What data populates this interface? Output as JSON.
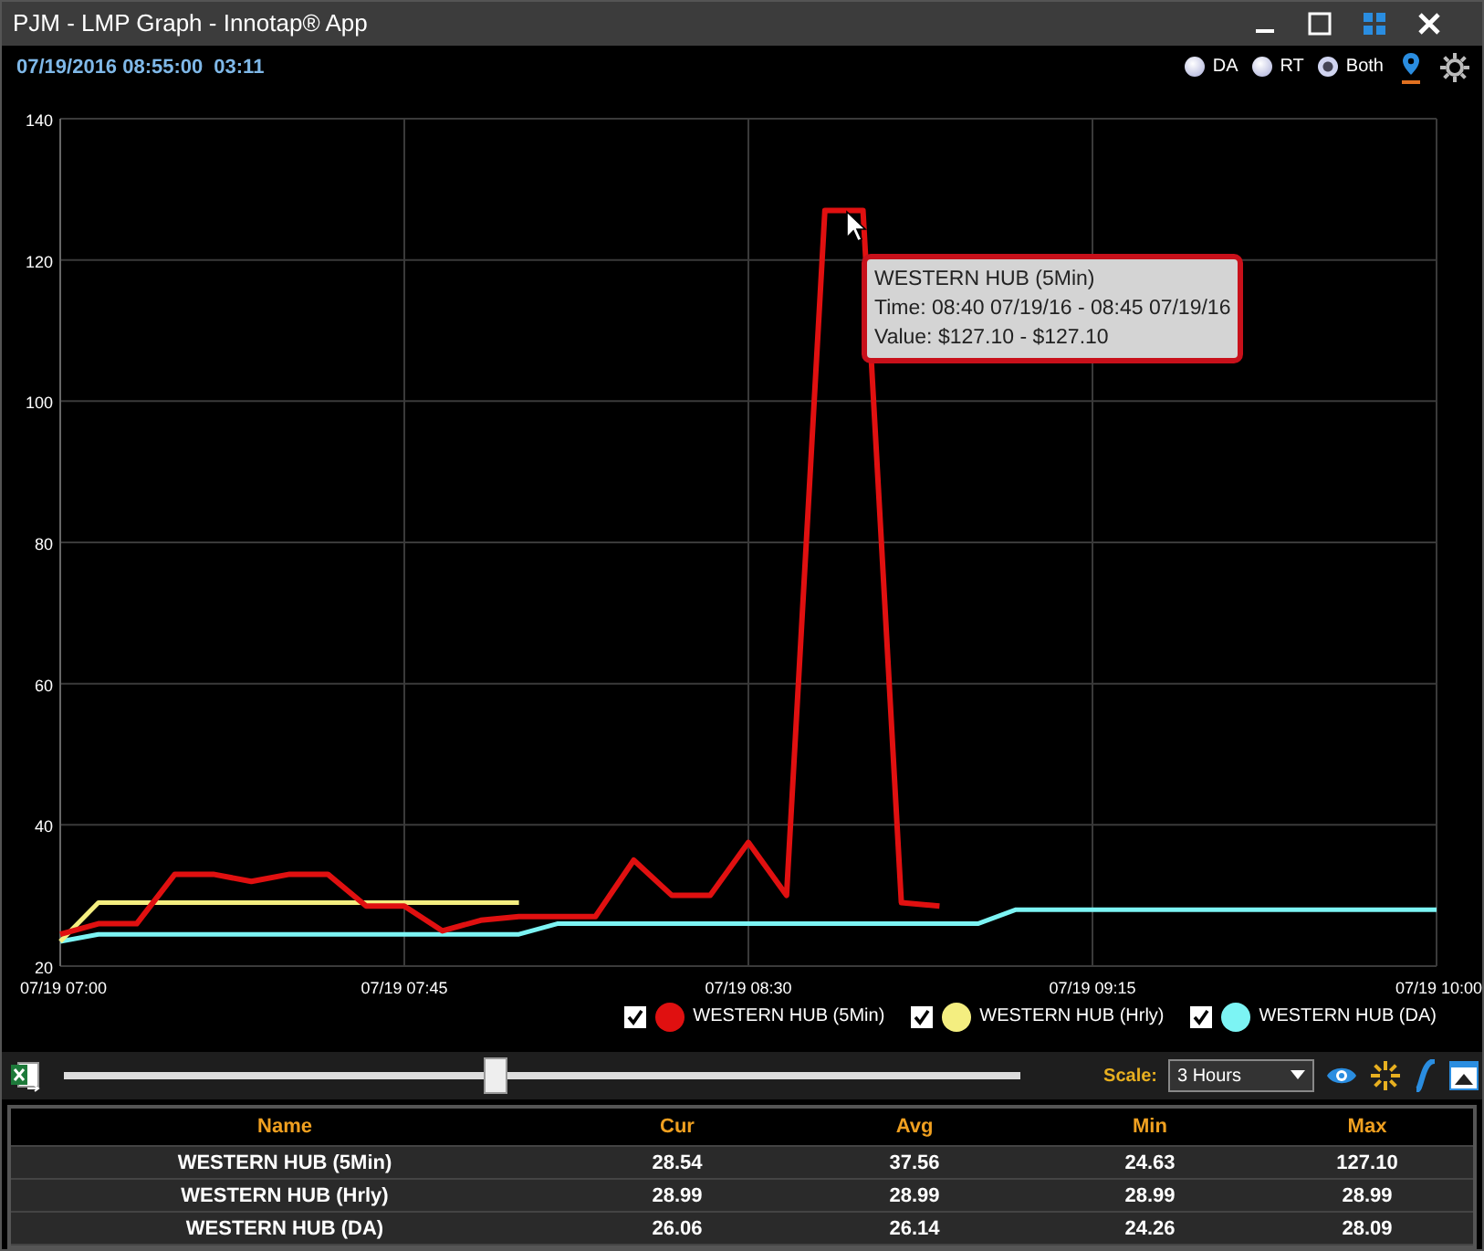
{
  "window": {
    "title": "PJM - LMP Graph - Innotap® App"
  },
  "header": {
    "datetime": "07/19/2016 08:55:00",
    "countdown": "03:11",
    "modes": [
      {
        "label": "DA",
        "selected": false
      },
      {
        "label": "RT",
        "selected": false
      },
      {
        "label": "Both",
        "selected": true
      }
    ]
  },
  "chart": {
    "chart_data": {
      "type": "line",
      "grid": true,
      "categories": [
        "07/19 07:00",
        null,
        null,
        null,
        null,
        null,
        null,
        null,
        null,
        "07/19 07:45",
        null,
        null,
        null,
        null,
        null,
        null,
        null,
        null,
        "07/19 08:30",
        null,
        null,
        null,
        null,
        null,
        null,
        null,
        null,
        "07/19 09:15",
        null,
        null,
        null,
        null,
        null,
        null,
        null,
        null,
        "07/19 10:00"
      ],
      "ylim": [
        20,
        140
      ],
      "yticks": [
        20,
        40,
        60,
        80,
        100,
        120,
        140
      ],
      "series": [
        {
          "name": "WESTERN HUB (5Min)",
          "color": "#e01010",
          "values": [
            24.5,
            26,
            26,
            33,
            33,
            32,
            33,
            33,
            28.5,
            28.5,
            25,
            26.5,
            27,
            27,
            27,
            35,
            30,
            30,
            37.5,
            30,
            127,
            127,
            29,
            28.5,
            null,
            null,
            null,
            null,
            null,
            null,
            null,
            null,
            null,
            null,
            null,
            null,
            null
          ]
        },
        {
          "name": "WESTERN HUB (Hrly)",
          "color": "#f4ee80",
          "values": [
            23.5,
            29,
            29,
            29,
            29,
            29,
            29,
            29,
            29,
            29,
            29,
            29,
            29,
            null,
            null,
            null,
            null,
            null,
            null,
            null,
            null,
            null,
            null,
            null,
            null,
            null,
            null,
            null,
            null,
            null,
            null,
            null,
            null,
            null,
            null,
            null,
            null
          ]
        },
        {
          "name": "WESTERN HUB (DA)",
          "color": "#7cf4f4",
          "values": [
            23.5,
            24.5,
            24.5,
            24.5,
            24.5,
            24.5,
            24.5,
            24.5,
            24.5,
            24.5,
            24.5,
            24.5,
            24.5,
            26,
            26,
            26,
            26,
            26,
            26,
            26,
            26,
            26,
            26,
            26,
            26,
            28,
            28,
            28,
            28,
            28,
            28,
            28,
            28,
            28,
            28,
            28,
            28
          ]
        }
      ]
    },
    "tooltip": {
      "lines": [
        "WESTERN HUB (5Min)",
        "Time: 08:40 07/19/16 - 08:45 07/19/16",
        "Value: $127.10 - $127.10"
      ]
    },
    "legend": [
      {
        "checked": true
      },
      {
        "checked": true
      },
      {
        "checked": true
      }
    ]
  },
  "controls": {
    "slider": {
      "level": 0.45
    },
    "scale_label": "Scale:",
    "scale": "3 Hours"
  },
  "table": {
    "columns": [
      "Name",
      "Cur",
      "Avg",
      "Min",
      "Max"
    ],
    "rows": [
      [
        "WESTERN HUB (5Min)",
        "28.54",
        "37.56",
        "24.63",
        "127.10"
      ],
      [
        "WESTERN HUB (Hrly)",
        "28.99",
        "28.99",
        "28.99",
        "28.99"
      ],
      [
        "WESTERN HUB (DA)",
        "26.06",
        "26.14",
        "24.26",
        "28.09"
      ]
    ]
  }
}
